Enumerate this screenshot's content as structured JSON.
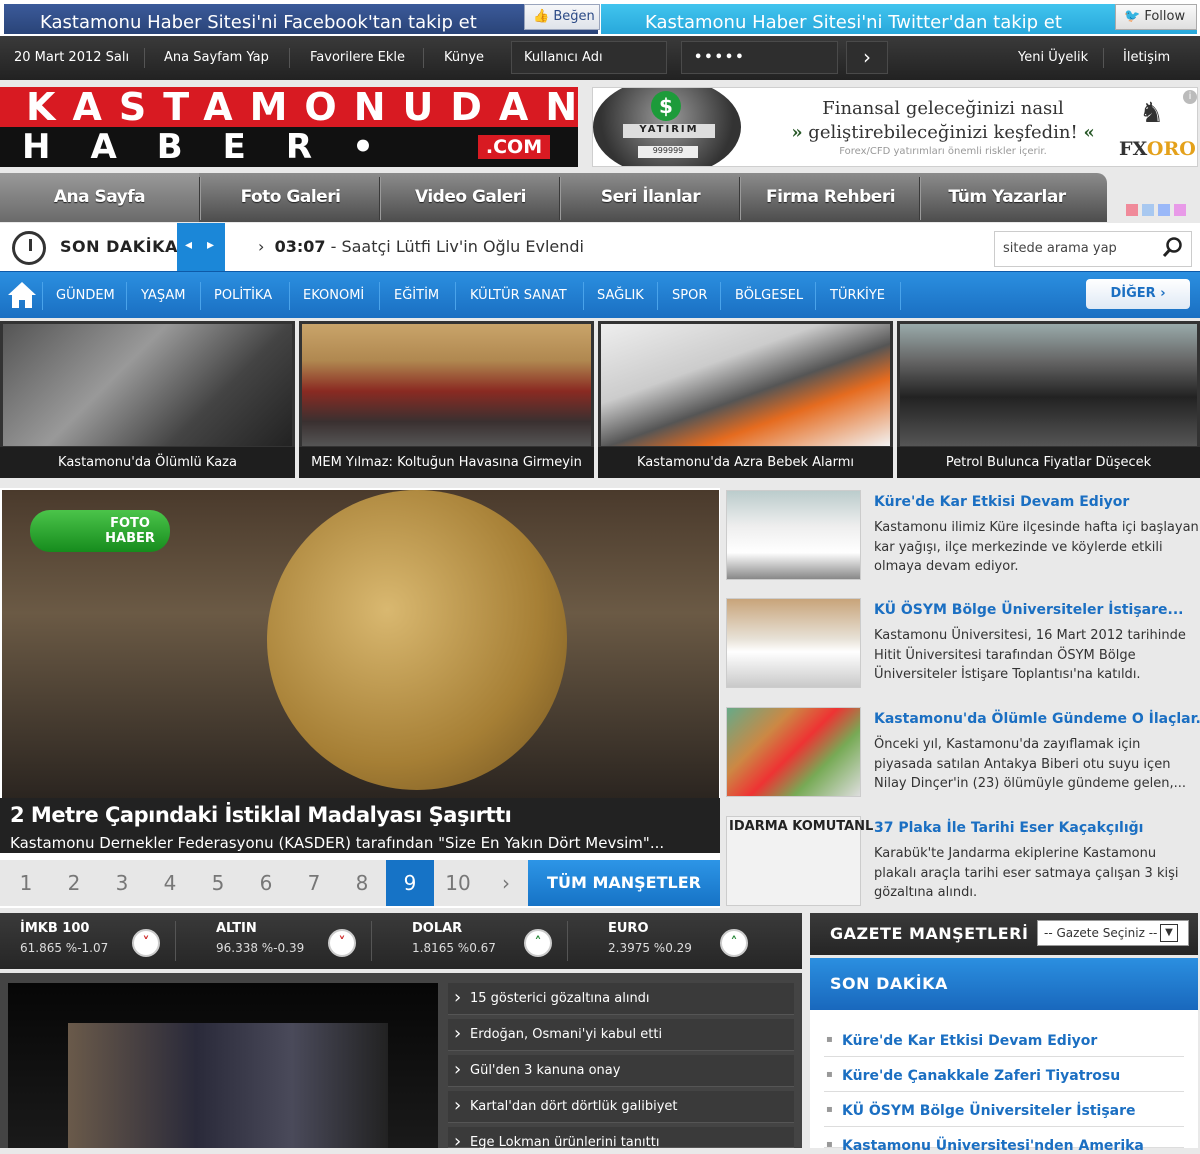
{
  "social": {
    "facebook_text": "Kastamonu Haber Sitesi'ni Facebook'tan takip et",
    "like_label": "Beğen",
    "twitter_text": "Kastamonu Haber Sitesi'ni Twitter'dan takip et",
    "follow_label": "Follow"
  },
  "topbar": {
    "date": "20 Mart 2012 Salı",
    "links": [
      "Ana Sayfam Yap",
      "Favorilere Ekle",
      "Künye"
    ],
    "username_placeholder": "Kullanıcı Adı",
    "password_value": "•••••",
    "register": "Yeni Üyelik",
    "contact": "İletişim"
  },
  "logo": {
    "line1": "KASTAMONUDAN",
    "line2": "HABER•",
    "com": ".COM"
  },
  "ad": {
    "badge": "YATIRIM",
    "digits": "999999",
    "line1": "Finansal geleceğinizi nasıl",
    "line2": "geliştirebileceğinizi keşfedin!",
    "line3": "Forex/CFD yatırımları önemli riskler içerir.",
    "brand_a": "FX",
    "brand_b": "ORO"
  },
  "nav": {
    "items": [
      "Ana Sayfa",
      "Foto Galeri",
      "Video Galeri",
      "Seri İlanlar",
      "Firma Rehberi",
      "Tüm Yazarlar"
    ],
    "swatches": [
      "#f08a9a",
      "#a8c8f0",
      "#9ab8f8",
      "#e89ae8"
    ]
  },
  "breaking": {
    "label": "SON DAKİKA",
    "time": "03:07",
    "text": "Saatçi Lütfi Liv'in Oğlu Evlendi",
    "search_placeholder": "sitede arama yap"
  },
  "categories": [
    "GÜNDEM",
    "YAŞAM",
    "POLİTİKA",
    "EKONOMİ",
    "EĞİTİM",
    "KÜLTÜR SANAT",
    "SAĞLIK",
    "SPOR",
    "BÖLGESEL",
    "TÜRKİYE"
  ],
  "more_label": "DİĞER",
  "thumbs": [
    "Kastamonu'da Ölümlü Kaza",
    "MEM Yılmaz: Koltuğun Havasına Girmeyin",
    "Kastamonu'da Azra Bebek Alarmı",
    "Petrol Bulunca Fiyatlar Düşecek"
  ],
  "feature": {
    "badge_line1": "FOTO",
    "badge_line2": "HABER",
    "title": "2 Metre Çapındaki İstiklal Madalyası Şaşırttı",
    "desc": "Kastamonu Dernekler Federasyonu (KASDER) tarafından \"Size En Yakın Dört Mevsim\"...",
    "pages": [
      "1",
      "2",
      "3",
      "4",
      "5",
      "6",
      "7",
      "8",
      "9",
      "10",
      "›"
    ],
    "active_page": "9",
    "all_label": "TÜM MANŞETLER"
  },
  "side_news": [
    {
      "title": "Küre'de Kar Etkisi Devam Ediyor",
      "desc": "Kastamonu ilimiz Küre ilçesinde hafta içi başlayan kar yağışı, ilçe merkezinde ve köylerde etkili olmaya devam ediyor."
    },
    {
      "title": "KÜ ÖSYM Bölge Üniversiteler İstişare...",
      "desc": "Kastamonu Üniversitesi, 16 Mart 2012 tarihinde Hitit Üniversitesi tarafından ÖSYM Bölge Üniversiteler İstişare Toplantısı'na katıldı."
    },
    {
      "title": "Kastamonu'da Ölümle Gündeme O İlaçlar...",
      "desc": "Önceki yıl, Kastamonu'da zayıflamak için piyasada satılan Antakya Biberi otu suyu içen Nilay Dinçer'in (23) ölümüyle gündeme gelen,..."
    },
    {
      "title": "37 Plaka İle Tarihi Eser Kaçakçılığı",
      "desc": "Karabük'te Jandarma ekiplerine Kastamonu plakalı araçla tarihi eser satmaya çalışan 3 kişi gözaltına alındı."
    }
  ],
  "side_news_pic4_text": "IDARMA KOMUTANL",
  "markets": [
    {
      "name": "İMKB 100",
      "value": "61.865 %-1.07",
      "dir": "down"
    },
    {
      "name": "ALTIN",
      "value": "96.338 %-0.39",
      "dir": "down"
    },
    {
      "name": "DOLAR",
      "value": "1.8165 %0.67",
      "dir": "up"
    },
    {
      "name": "EURO",
      "value": "2.3975 %0.29",
      "dir": "up"
    }
  ],
  "lower_news": [
    "15 gösterici gözaltına alındı",
    "Erdoğan, Osmani'yi kabul etti",
    "Gül'den 3 kanuna onay",
    "Kartal'dan dört dörtlük galibiyet",
    "Ege Lokman ürünlerini tanıttı"
  ],
  "gazete": {
    "title": "GAZETE MANŞETLERİ",
    "select": "-- Gazete Seçiniz --"
  },
  "son_dakika": {
    "title": "SON DAKİKA",
    "items": [
      "Küre'de Kar Etkisi Devam Ediyor",
      "Küre'de Çanakkale Zaferi Tiyatrosu",
      "KÜ ÖSYM Bölge Üniversiteler İstişare",
      "Kastamonu Üniversitesi'nden Amerika"
    ]
  }
}
